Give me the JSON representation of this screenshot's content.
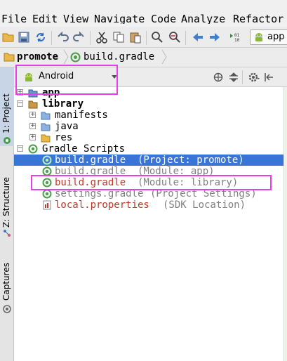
{
  "menu": {
    "items": [
      "File",
      "Edit",
      "View",
      "Navigate",
      "Code",
      "Analyze",
      "Refactor"
    ]
  },
  "toolbar": {
    "icons": [
      "folder-open-icon",
      "save-icon",
      "sync-icon",
      "undo-icon",
      "redo-icon",
      "cut-icon",
      "copy-icon",
      "paste-icon",
      "find-icon",
      "replace-icon",
      "back-icon",
      "forward-icon",
      "make-project-icon",
      "android-icon"
    ],
    "run_config_label": "app"
  },
  "breadcrumb": {
    "project": "promote",
    "file": "build.gradle"
  },
  "left_tabs": {
    "project": "1: Project",
    "structure": "Z: Structure",
    "captures": "Captures"
  },
  "panel": {
    "view_mode": "Android"
  },
  "tree": {
    "app": "app",
    "library": "library",
    "manifests": "manifests",
    "java": "java",
    "res": "res",
    "gradle_scripts": "Gradle Scripts",
    "bg_project_name": "build.gradle",
    "bg_project_note": "(Project: promote)",
    "bg_app_name": "build.gradle",
    "bg_app_note": "(Module: app)",
    "bg_library_name": "build.gradle",
    "bg_library_note": "(Module: library)",
    "settings_name": "settings.gradle",
    "settings_note": "(Project Settings)",
    "local_name": "local.properties",
    "local_note": "(SDK Location)"
  },
  "colors": {
    "selection": "#3875d7",
    "highlight": "#e83ee8",
    "gradle_green": "#4a9e4a",
    "folder_blue": "#4a7ab8",
    "android_green": "#8ab833"
  }
}
